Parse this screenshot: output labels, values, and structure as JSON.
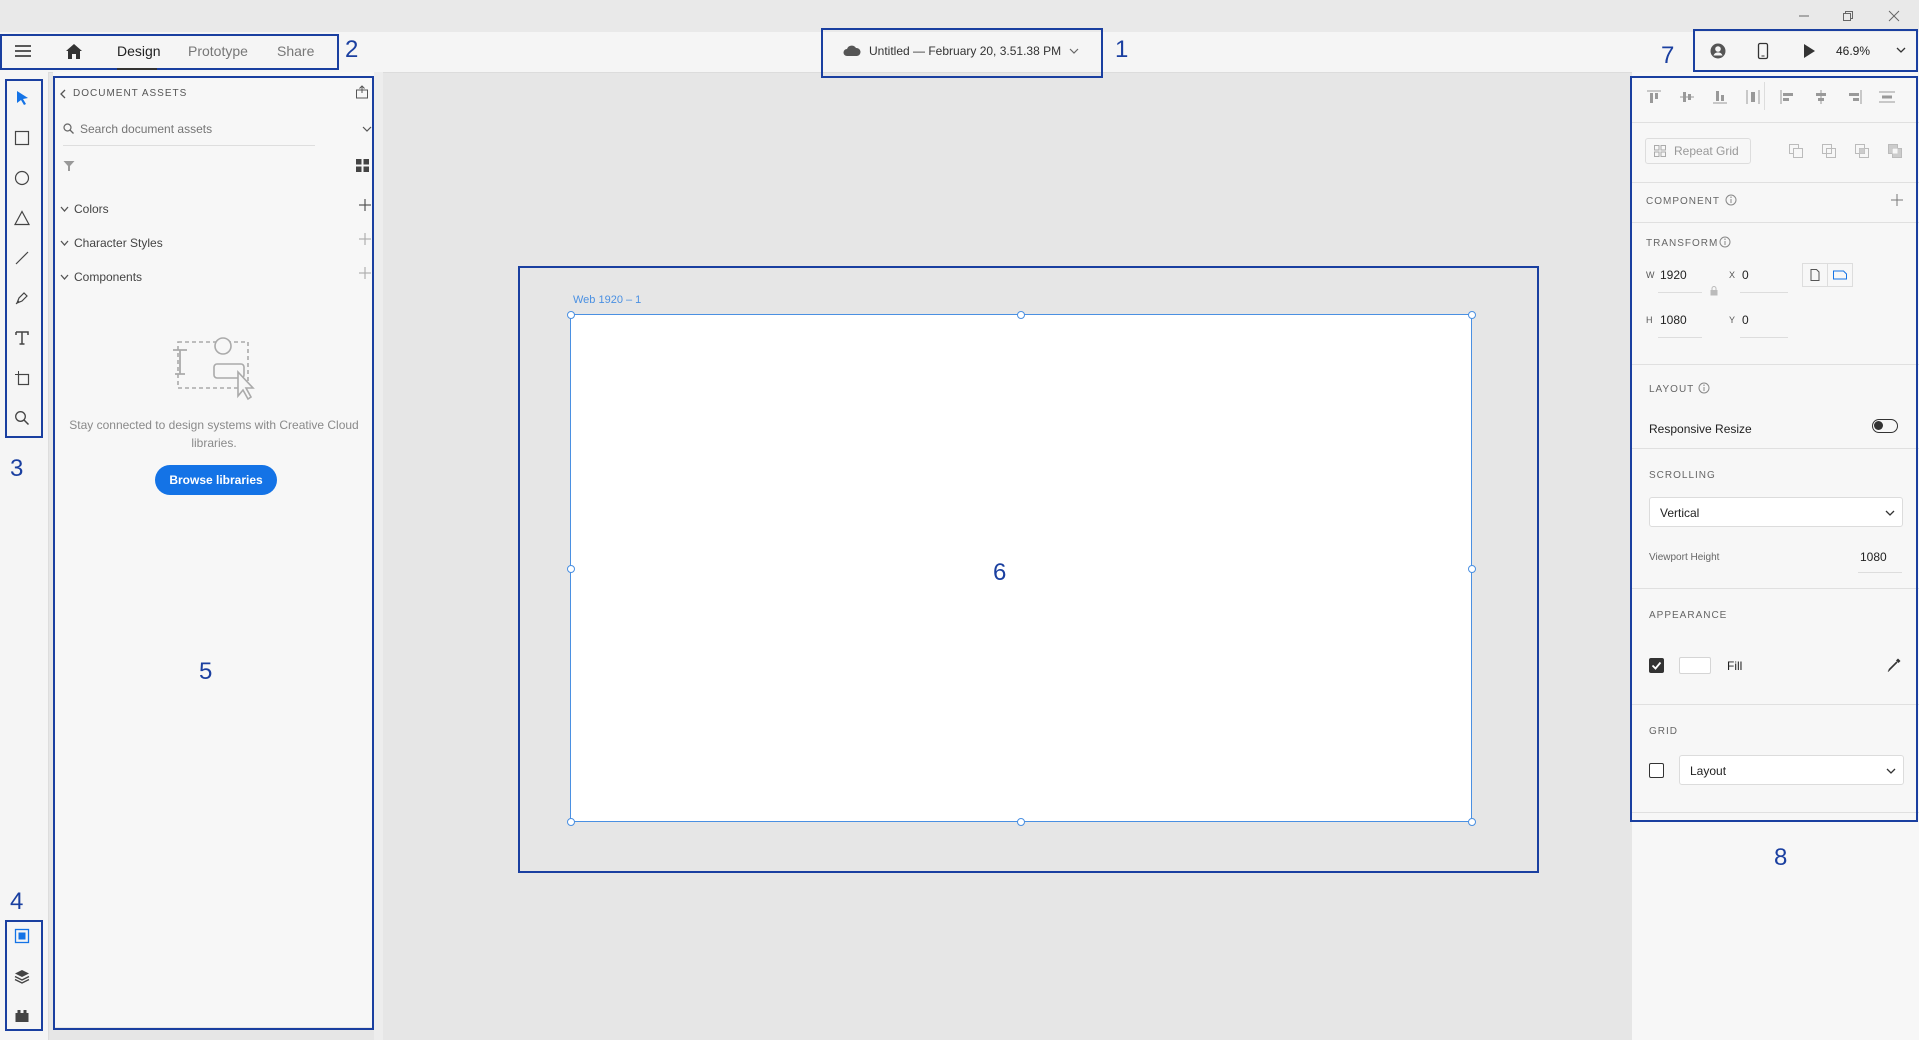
{
  "window": {
    "minimize_icon": "minimize-icon",
    "restore_icon": "restore-icon",
    "close_icon": "close-icon"
  },
  "tabs": [
    {
      "label": "Design",
      "active": true
    },
    {
      "label": "Prototype"
    },
    {
      "label": "Share"
    }
  ],
  "document": {
    "title": "Untitled — February 20, 3.51.38 PM"
  },
  "toolbar_right": {
    "zoom": "46.9%"
  },
  "callouts": {
    "n1": "1",
    "n2": "2",
    "n3": "3",
    "n4": "4",
    "n5": "5",
    "n6": "6",
    "n7": "7",
    "n8": "8"
  },
  "assets": {
    "header": "DOCUMENT ASSETS",
    "search_placeholder": "Search document assets",
    "sections": [
      {
        "label": "Colors"
      },
      {
        "label": "Character Styles"
      },
      {
        "label": "Components"
      }
    ],
    "empty_text": "Stay connected to design systems with Creative Cloud libraries.",
    "browse_button": "Browse libraries"
  },
  "canvas": {
    "artboard_name": "Web 1920 – 1"
  },
  "properties": {
    "repeat_grid": "Repeat Grid",
    "component_label": "COMPONENT",
    "transform_label": "TRANSFORM",
    "w_label": "W",
    "w_value": "1920",
    "x_label": "X",
    "x_value": "0",
    "h_label": "H",
    "h_value": "1080",
    "y_label": "Y",
    "y_value": "0",
    "layout_label": "LAYOUT",
    "responsive_resize": "Responsive Resize",
    "responsive_on": false,
    "scrolling_label": "SCROLLING",
    "scrolling_value": "Vertical",
    "viewport_height_label": "Viewport Height",
    "viewport_height_value": "1080",
    "appearance_label": "APPEARANCE",
    "fill_label": "Fill",
    "fill_checked": true,
    "fill_color": "#ffffff",
    "grid_label": "GRID",
    "grid_value": "Layout",
    "grid_checked": false
  },
  "colors": {
    "accent": "#1473e6",
    "callout": "#1a3fa0",
    "selection": "#4a90e2"
  }
}
